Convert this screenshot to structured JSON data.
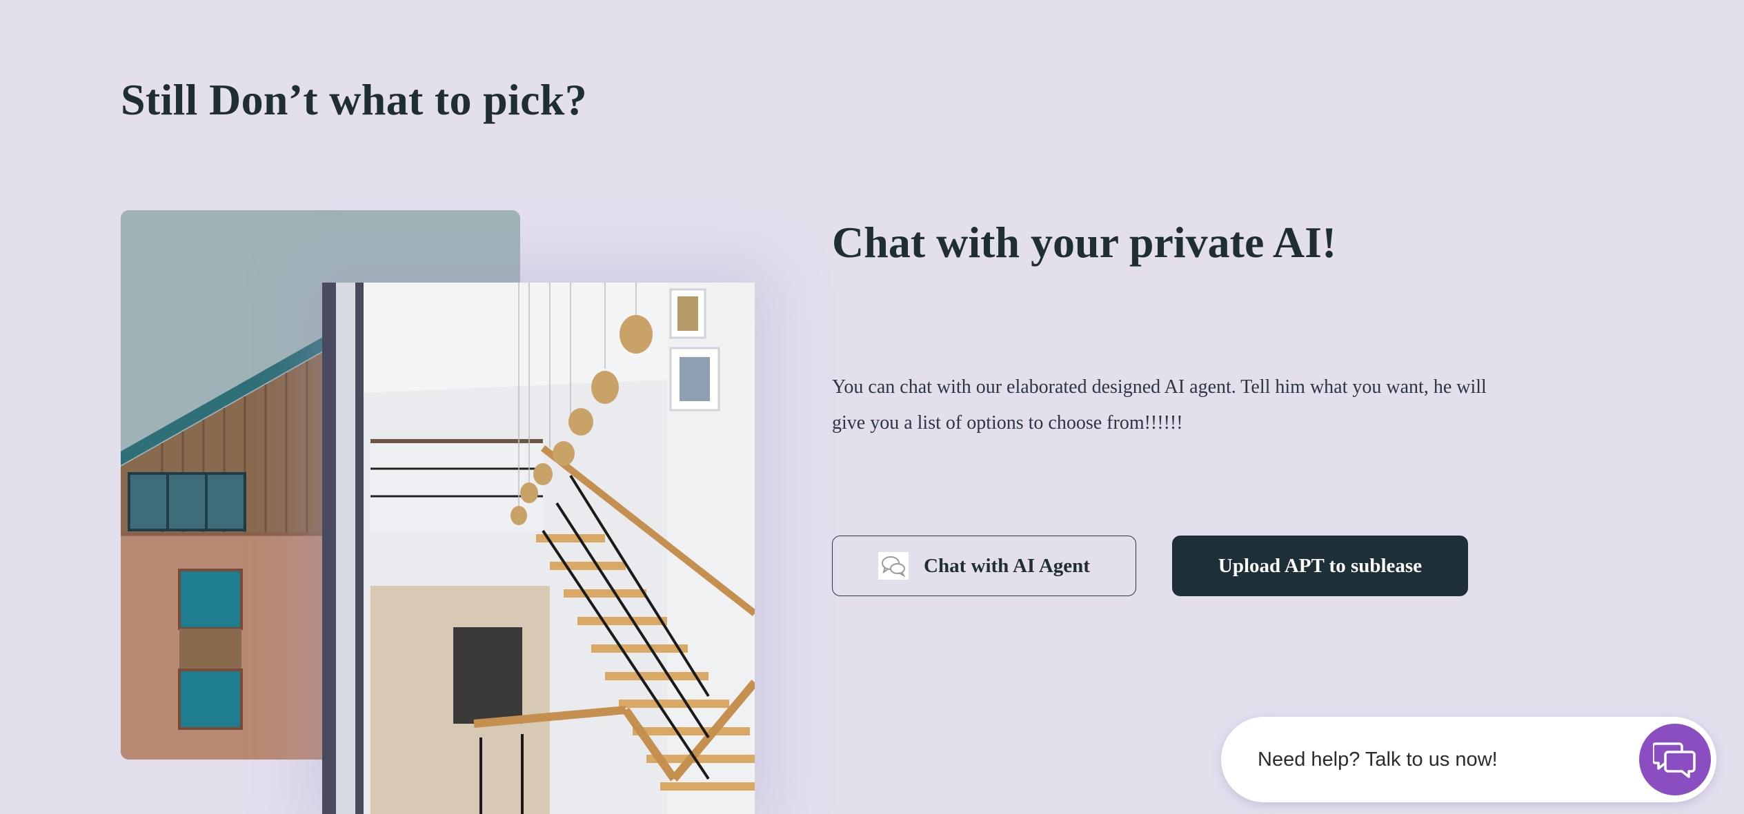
{
  "heading": "Still Don’t what to pick?",
  "feature": {
    "title": "Chat with your private AI!",
    "description": "You can chat with our elaborated designed AI agent. Tell him what you want, he will give you a list of options to choose from!!!!!!"
  },
  "buttons": {
    "chat_label": "Chat with AI Agent",
    "upload_label": "Upload APT to sublease"
  },
  "help_widget": {
    "text": "Need help? Talk to us now!",
    "icon": "chat-bubbles-icon"
  },
  "colors": {
    "background": "#e3dfed",
    "heading": "#1f2d35",
    "primary_button": "#1f2f37",
    "help_accent": "#8a4ec0"
  }
}
